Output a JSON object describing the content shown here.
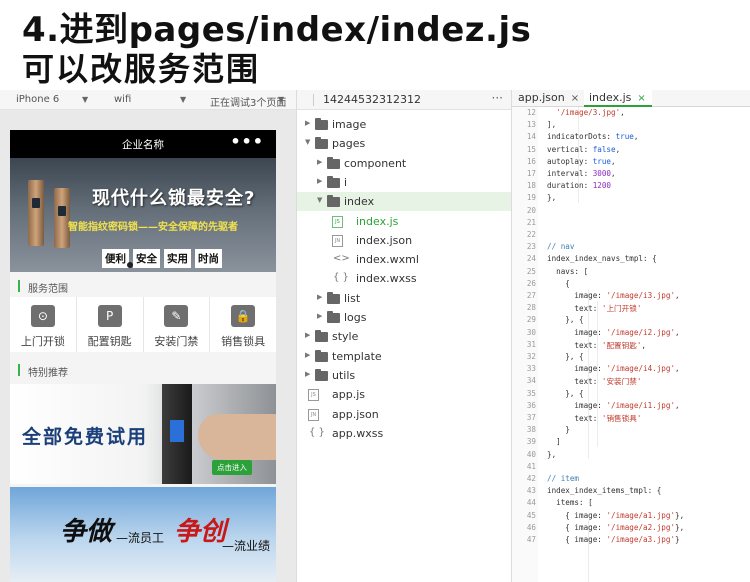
{
  "heading": {
    "line1": "4.进到pages/index/indez.js",
    "line2": "可以改服务范围"
  },
  "simulator": {
    "device": "iPhone 6",
    "network": "wifi",
    "status": "正在调试3个页面",
    "nav_title": "企业名称",
    "nav_more": "•••",
    "banner1": {
      "title": "现代什么锁最安全?",
      "subtitle": "智能指纹密码锁——安全保障的先驱者",
      "tags": [
        "便利",
        "安全",
        "实用",
        "时尚"
      ]
    },
    "section_services": "服务范围",
    "navs": [
      {
        "label": "上门开锁",
        "icon": "car-icon",
        "glyph": "⊙"
      },
      {
        "label": "配置钥匙",
        "icon": "key-icon",
        "glyph": "P"
      },
      {
        "label": "安装门禁",
        "icon": "wrench-icon",
        "glyph": "✎"
      },
      {
        "label": "销售锁具",
        "icon": "lock-icon",
        "glyph": "🔒"
      }
    ],
    "section_recommend": "特别推荐",
    "banner2": {
      "title": "全部免费试用",
      "button": "点击进入"
    },
    "banner3": {
      "char1": "争做",
      "text1": "—流员工",
      "char2": "争创",
      "text2": "—流业绩"
    }
  },
  "file_tree": {
    "project_id": "14244532312312",
    "more": "···",
    "items": [
      {
        "name": "image",
        "type": "folder",
        "depth": 0,
        "expanded": false
      },
      {
        "name": "pages",
        "type": "folder",
        "depth": 0,
        "expanded": true
      },
      {
        "name": "component",
        "type": "folder",
        "depth": 1,
        "expanded": false
      },
      {
        "name": "i",
        "type": "folder",
        "depth": 1,
        "expanded": false
      },
      {
        "name": "index",
        "type": "folder",
        "depth": 1,
        "expanded": true,
        "selected": true
      },
      {
        "name": "index.js",
        "type": "js",
        "depth": 2,
        "active": true
      },
      {
        "name": "index.json",
        "type": "json",
        "depth": 2
      },
      {
        "name": "index.wxml",
        "type": "wxml",
        "depth": 2
      },
      {
        "name": "index.wxss",
        "type": "wxss",
        "depth": 2
      },
      {
        "name": "list",
        "type": "folder",
        "depth": 1,
        "expanded": false
      },
      {
        "name": "logs",
        "type": "folder",
        "depth": 1,
        "expanded": false
      },
      {
        "name": "style",
        "type": "folder",
        "depth": 0,
        "expanded": false
      },
      {
        "name": "template",
        "type": "folder",
        "depth": 0,
        "expanded": false
      },
      {
        "name": "utils",
        "type": "folder",
        "depth": 0,
        "expanded": false
      },
      {
        "name": "app.js",
        "type": "js",
        "depth": 0
      },
      {
        "name": "app.json",
        "type": "json",
        "depth": 0
      },
      {
        "name": "app.wxss",
        "type": "wxss",
        "depth": 0
      }
    ]
  },
  "editor": {
    "tabs": [
      {
        "label": "app.json",
        "active": false
      },
      {
        "label": "index.js",
        "active": true
      }
    ],
    "close_glyph": "×",
    "lines": [
      {
        "n": "12",
        "t": "  '/image/3.jpg',"
      },
      {
        "n": "13",
        "t": "],"
      },
      {
        "n": "14",
        "t": "indicatorDots: true,"
      },
      {
        "n": "15",
        "t": "vertical: false,"
      },
      {
        "n": "16",
        "t": "autoplay: true,"
      },
      {
        "n": "17",
        "t": "interval: 3000,"
      },
      {
        "n": "18",
        "t": "duration: 1200"
      },
      {
        "n": "19",
        "t": "},"
      },
      {
        "n": "20",
        "t": ""
      },
      {
        "n": "21",
        "t": ""
      },
      {
        "n": "22",
        "t": ""
      },
      {
        "n": "23",
        "t": "// nav"
      },
      {
        "n": "24",
        "t": "index_index_navs_tmpl: {"
      },
      {
        "n": "25",
        "t": "  navs: ["
      },
      {
        "n": "26",
        "t": "    {"
      },
      {
        "n": "27",
        "t": "      image: '/image/i3.jpg',"
      },
      {
        "n": "28",
        "t": "      text: '上门开锁'"
      },
      {
        "n": "29",
        "t": "    }, {"
      },
      {
        "n": "30",
        "t": "      image: '/image/i2.jpg',"
      },
      {
        "n": "31",
        "t": "      text: '配置钥匙',"
      },
      {
        "n": "32",
        "t": "    }, {"
      },
      {
        "n": "33",
        "t": "      image: '/image/i4.jpg',"
      },
      {
        "n": "34",
        "t": "      text: '安装门禁'"
      },
      {
        "n": "35",
        "t": "    }, {"
      },
      {
        "n": "36",
        "t": "      image: '/image/i1.jpg',"
      },
      {
        "n": "37",
        "t": "      text: '销售锁具'"
      },
      {
        "n": "38",
        "t": "    }"
      },
      {
        "n": "39",
        "t": "  ]"
      },
      {
        "n": "40",
        "t": "},"
      },
      {
        "n": "41",
        "t": ""
      },
      {
        "n": "42",
        "t": "// item"
      },
      {
        "n": "43",
        "t": "index_index_items_tmpl: {"
      },
      {
        "n": "44",
        "t": "  items: ["
      },
      {
        "n": "45",
        "t": "    { image: '/image/a1.jpg'},"
      },
      {
        "n": "46",
        "t": "    { image: '/image/a2.jpg'},"
      },
      {
        "n": "47",
        "t": "    { image: '/image/a3.jpg'}"
      }
    ]
  }
}
